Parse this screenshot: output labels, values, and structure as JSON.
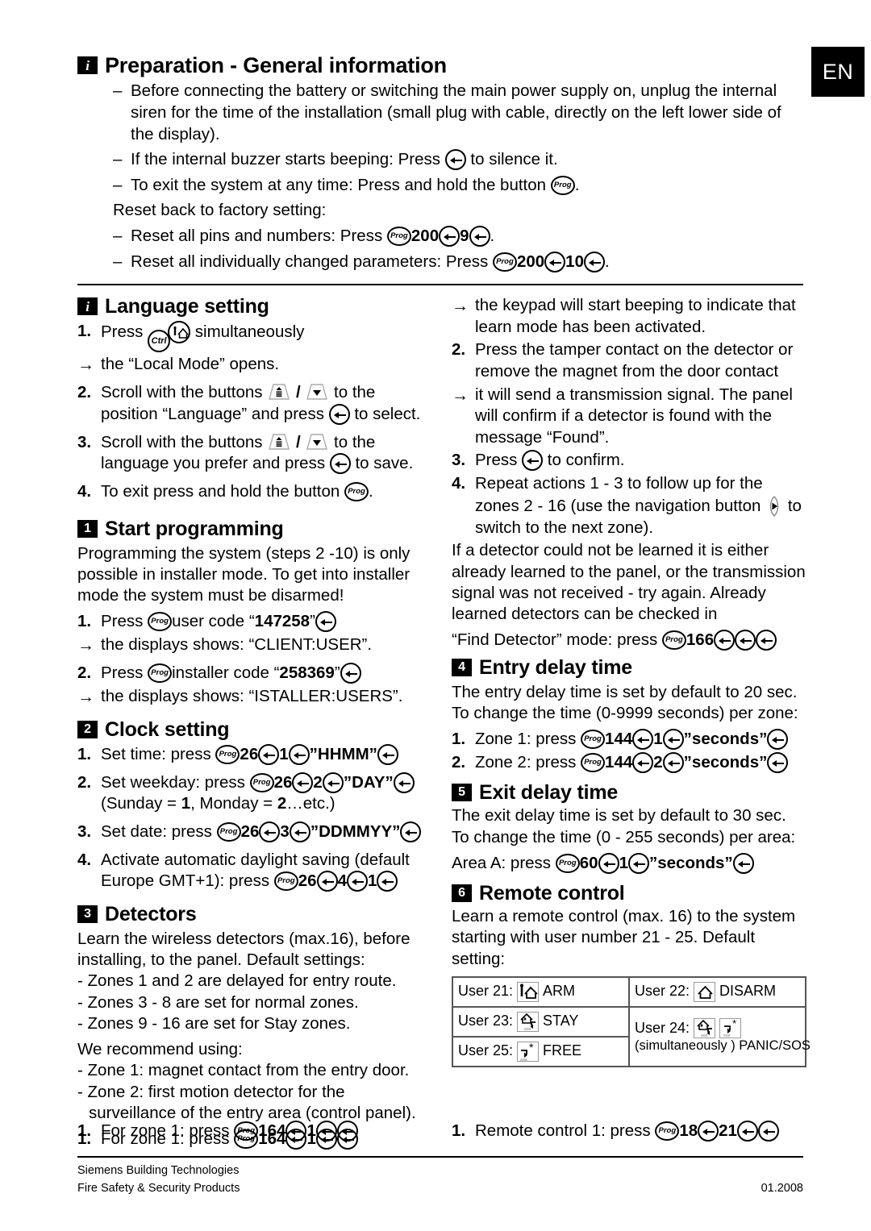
{
  "language_badge": "EN",
  "preparation": {
    "title": "Preparation - General information",
    "marker": "i",
    "bullets": [
      "Before connecting the battery or switching the main power supply on, unplug the internal siren for the time of the installation (small plug with cable, directly on the left lower side of the display).",
      "If the internal buzzer starts beeping: Press ",
      "To exit the system at any time: Press and hold the button "
    ],
    "bullet2_tail": " to silence it.",
    "bullet3_tail": ".",
    "reset_intro": "Reset back to factory setting:",
    "reset1_lead": "Reset all pins and numbers: Press ",
    "reset1_code": "200",
    "reset1_value": "9",
    "reset1_tail": ".",
    "reset2_lead": "Reset all individually changed parameters: Press ",
    "reset2_code": "200",
    "reset2_value": "10",
    "reset2_tail": "."
  },
  "language_setting": {
    "title": "Language setting",
    "marker": "i",
    "step1_num": "1.",
    "step1_lead": "Press ",
    "step1_tail": " simultaneously",
    "arrow1_num": "→",
    "arrow1_text": "the “Local Mode” opens.",
    "step2_num": "2.",
    "step2_lead": "Scroll with the buttons ",
    "step2_mid": " to the position “Language” and press ",
    "step2_tail": " to select.",
    "step3_num": "3.",
    "step3_lead": "Scroll with the buttons ",
    "step3_mid": " to the language you prefer and press ",
    "step3_tail": " to save.",
    "step4_num": "4.",
    "step4_lead": "To exit press and hold the button ",
    "step4_tail": "."
  },
  "start_programming": {
    "title": "Start programming",
    "marker": "1",
    "intro": "Programming the system (steps 2 -10) is only possible in installer mode. To get into installer mode the system must be disarmed!",
    "step1_num": "1.",
    "step1_lead": "Press ",
    "step1_mid": "user code “",
    "step1_code": "147258",
    "step1_quote": "”",
    "arrow1_num": "→",
    "arrow1_text": "the displays shows: “CLIENT:USER”.",
    "step2_num": "2.",
    "step2_lead": "Press ",
    "step2_mid": "installer code “",
    "step2_code": "258369",
    "step2_quote": "”",
    "arrow2_num": "→",
    "arrow2_text": "the displays shows: “ISTALLER:USERS”."
  },
  "clock_setting": {
    "title": "Clock setting",
    "marker": "2",
    "step1_num": "1.",
    "step1_lead": "Set time: press ",
    "step1_a": "26",
    "step1_b": "1",
    "step1_c": "”HHMM”",
    "step2_num": "2.",
    "step2_lead": "Set weekday: press ",
    "step2_a": "26",
    "step2_b": "2",
    "step2_c": "”DAY”",
    "step2_note_pre": "(Sunday = ",
    "step2_note_v1": "1",
    "step2_note_mid": ", Monday = ",
    "step2_note_v2": "2",
    "step2_note_post": "…etc.)",
    "step3_num": "3.",
    "step3_lead": "Set date: press ",
    "step3_a": "26",
    "step3_b": "3",
    "step3_c": "”DDMMYY”",
    "step4_num": "4.",
    "step4_lead": "Activate automatic daylight saving (default Europe GMT+1): press ",
    "step4_a": "26",
    "step4_b": "4",
    "step4_c": "1"
  },
  "detectors": {
    "title": "Detectors",
    "marker": "3",
    "intro": "Learn the wireless detectors (max.16), before installing, to the panel. Default settings:",
    "defaults": [
      "- Zones 1 and 2 are delayed for entry route.",
      "- Zones 3 - 8 are set for normal zones.",
      "- Zones 9 - 16 are set for Stay zones."
    ],
    "recommend_lead": "We recommend using:",
    "recommend": [
      "- Zone 1: magnet contact from the entry door.",
      "- Zone 2: first motion detector for the surveillance of the entry area (control panel)."
    ],
    "step1_num": "1.",
    "step1_lead": "For zone 1: press ",
    "step1_a": "164",
    "step1_b": "1",
    "arrow1_num": "→",
    "arrow1_text": "the keypad will start beeping to indicate that  learn mode has been activated.",
    "step2_num": "2.",
    "step2_text": "Press the tamper contact on the detector or remove the magnet from the door contact",
    "arrow2_num": "→",
    "arrow2_text": "it will send a transmission signal. The panel will confirm if a detector is found with the message “Found”.",
    "step3_num": "3.",
    "step3_lead": "Press ",
    "step3_tail": " to confirm.",
    "step4_num": "4.",
    "step4_lead": "Repeat actions 1 - 3 to follow up for the zones 2 - 16 (use the navigation button ",
    "step4_tail": " to switch to the next zone).",
    "outro": "If a detector could not be learned it is either already learned to the panel, or the transmission signal was not received - try again. Already learned detectors can be checked in",
    "find_lead": "“Find Detector” mode: press ",
    "find_code": "166"
  },
  "entry_delay": {
    "title": "Entry delay time",
    "marker": "4",
    "intro": "The entry delay time is set by default to 20 sec. To change the time (0-9999 seconds) per zone:",
    "step1_num": "1.",
    "step1_lead": "Zone 1: press ",
    "step1_a": "144",
    "step1_b": "1",
    "step1_c": "”seconds”",
    "step2_num": "2.",
    "step2_lead": "Zone 2: press ",
    "step2_a": "144",
    "step2_b": "2",
    "step2_c": "”seconds”"
  },
  "exit_delay": {
    "title": "Exit delay time",
    "marker": "5",
    "intro": "The exit delay time is set by default to 30 sec. To change the time (0 - 255 seconds) per area:",
    "step_lead": "Area A: press ",
    "step_a": "60",
    "step_b": "1",
    "step_c": "”seconds”"
  },
  "remote_control": {
    "title": "Remote control",
    "marker": "6",
    "intro": "Learn a remote control (max. 16) to the system starting with user number 21 - 25. Default setting:",
    "table": {
      "user21_label": "User 21:",
      "user21_icon": "arm-icon",
      "user21_action": "ARM",
      "user22_label": "User 22:",
      "user22_icon": "disarm-icon",
      "user22_action": "DISARM",
      "user23_label": "User 23:",
      "user23_icon": "stay-icon",
      "user23_action": "STAY",
      "user24_label": "User 24:",
      "user24_icon_a": "stay-icon",
      "user24_icon_b": "free-icon",
      "user24_note": "(simultaneously ) PANIC/SOS",
      "user25_label": "User 25:",
      "user25_icon": "free-icon",
      "user25_action": "FREE"
    },
    "step1_num": "1.",
    "step1_lead": "Remote control 1: press ",
    "step1_a": "18",
    "step1_b": "21"
  },
  "footer": {
    "line1": "Siemens Building Technologies",
    "line2": "Fire Safety & Security Products",
    "date": "01.2008"
  }
}
